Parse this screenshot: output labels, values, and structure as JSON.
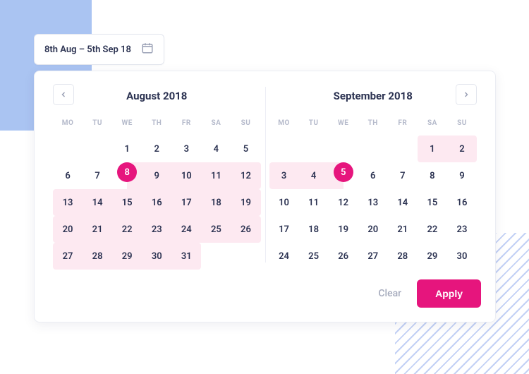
{
  "input": {
    "value": "8th Aug – 5th Sep 18"
  },
  "buttons": {
    "clear": "Clear",
    "apply": "Apply"
  },
  "weekdays": [
    "MO",
    "TU",
    "WE",
    "TH",
    "FR",
    "SA",
    "SU"
  ],
  "months": [
    {
      "title": "August 2018",
      "nav": "prev",
      "range_criteria": {
        "start": 8,
        "end": 31,
        "endpoint": 8,
        "endpoint_type": "start"
      },
      "cells": [
        null,
        null,
        1,
        2,
        3,
        4,
        5,
        6,
        7,
        8,
        9,
        10,
        11,
        12,
        13,
        14,
        15,
        16,
        17,
        18,
        19,
        20,
        21,
        22,
        23,
        24,
        25,
        26,
        27,
        28,
        29,
        30,
        31,
        null,
        null
      ]
    },
    {
      "title": "September 2018",
      "nav": "next",
      "range_criteria": {
        "start": 1,
        "end": 5,
        "endpoint": 5,
        "endpoint_type": "end"
      },
      "cells": [
        null,
        null,
        null,
        null,
        null,
        1,
        2,
        3,
        4,
        5,
        6,
        7,
        8,
        9,
        10,
        11,
        12,
        13,
        14,
        15,
        16,
        17,
        18,
        19,
        20,
        21,
        22,
        23,
        24,
        25,
        26,
        27,
        28,
        29,
        30
      ]
    }
  ]
}
